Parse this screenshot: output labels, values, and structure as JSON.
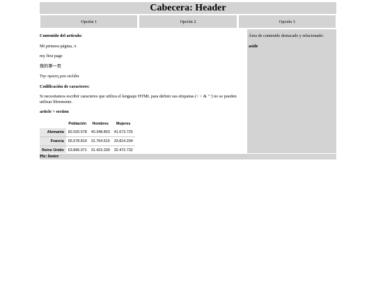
{
  "header": {
    "title": "Cabecera: Header"
  },
  "nav": {
    "items": [
      "Opción 1",
      "Opción 2",
      "Opción 3"
    ]
  },
  "article": {
    "heading": "Contenido del artículo:",
    "lines": [
      "Mi primera página, π",
      "my first page",
      "我的第一页",
      "Την πρώτη μου σελίδα"
    ],
    "encoding_heading": "Codificación de caracteres:",
    "encoding_text": "Si necesitamos escribir caracteres que utiliza el lenguaje HTML para definir sus etiquetas (< > & \"  ') no se pueden utilizar libremente.",
    "section_label": "article > section"
  },
  "table": {
    "headers": [
      "",
      "Población",
      "Hombres",
      "Mujeres"
    ],
    "rows": [
      [
        "Alemania",
        "82.020.578",
        "40.348.853",
        "41.673.725"
      ],
      [
        "Francia",
        "65.578.819",
        "31.764.615",
        "33.814.204"
      ],
      [
        "Reino Unido",
        "63.896.071",
        "31.423.339",
        "32.472.732"
      ]
    ]
  },
  "aside": {
    "text": "Área de contenido destacado y relacionado:",
    "label": "aside"
  },
  "footer": {
    "text": "Pie: footer"
  }
}
